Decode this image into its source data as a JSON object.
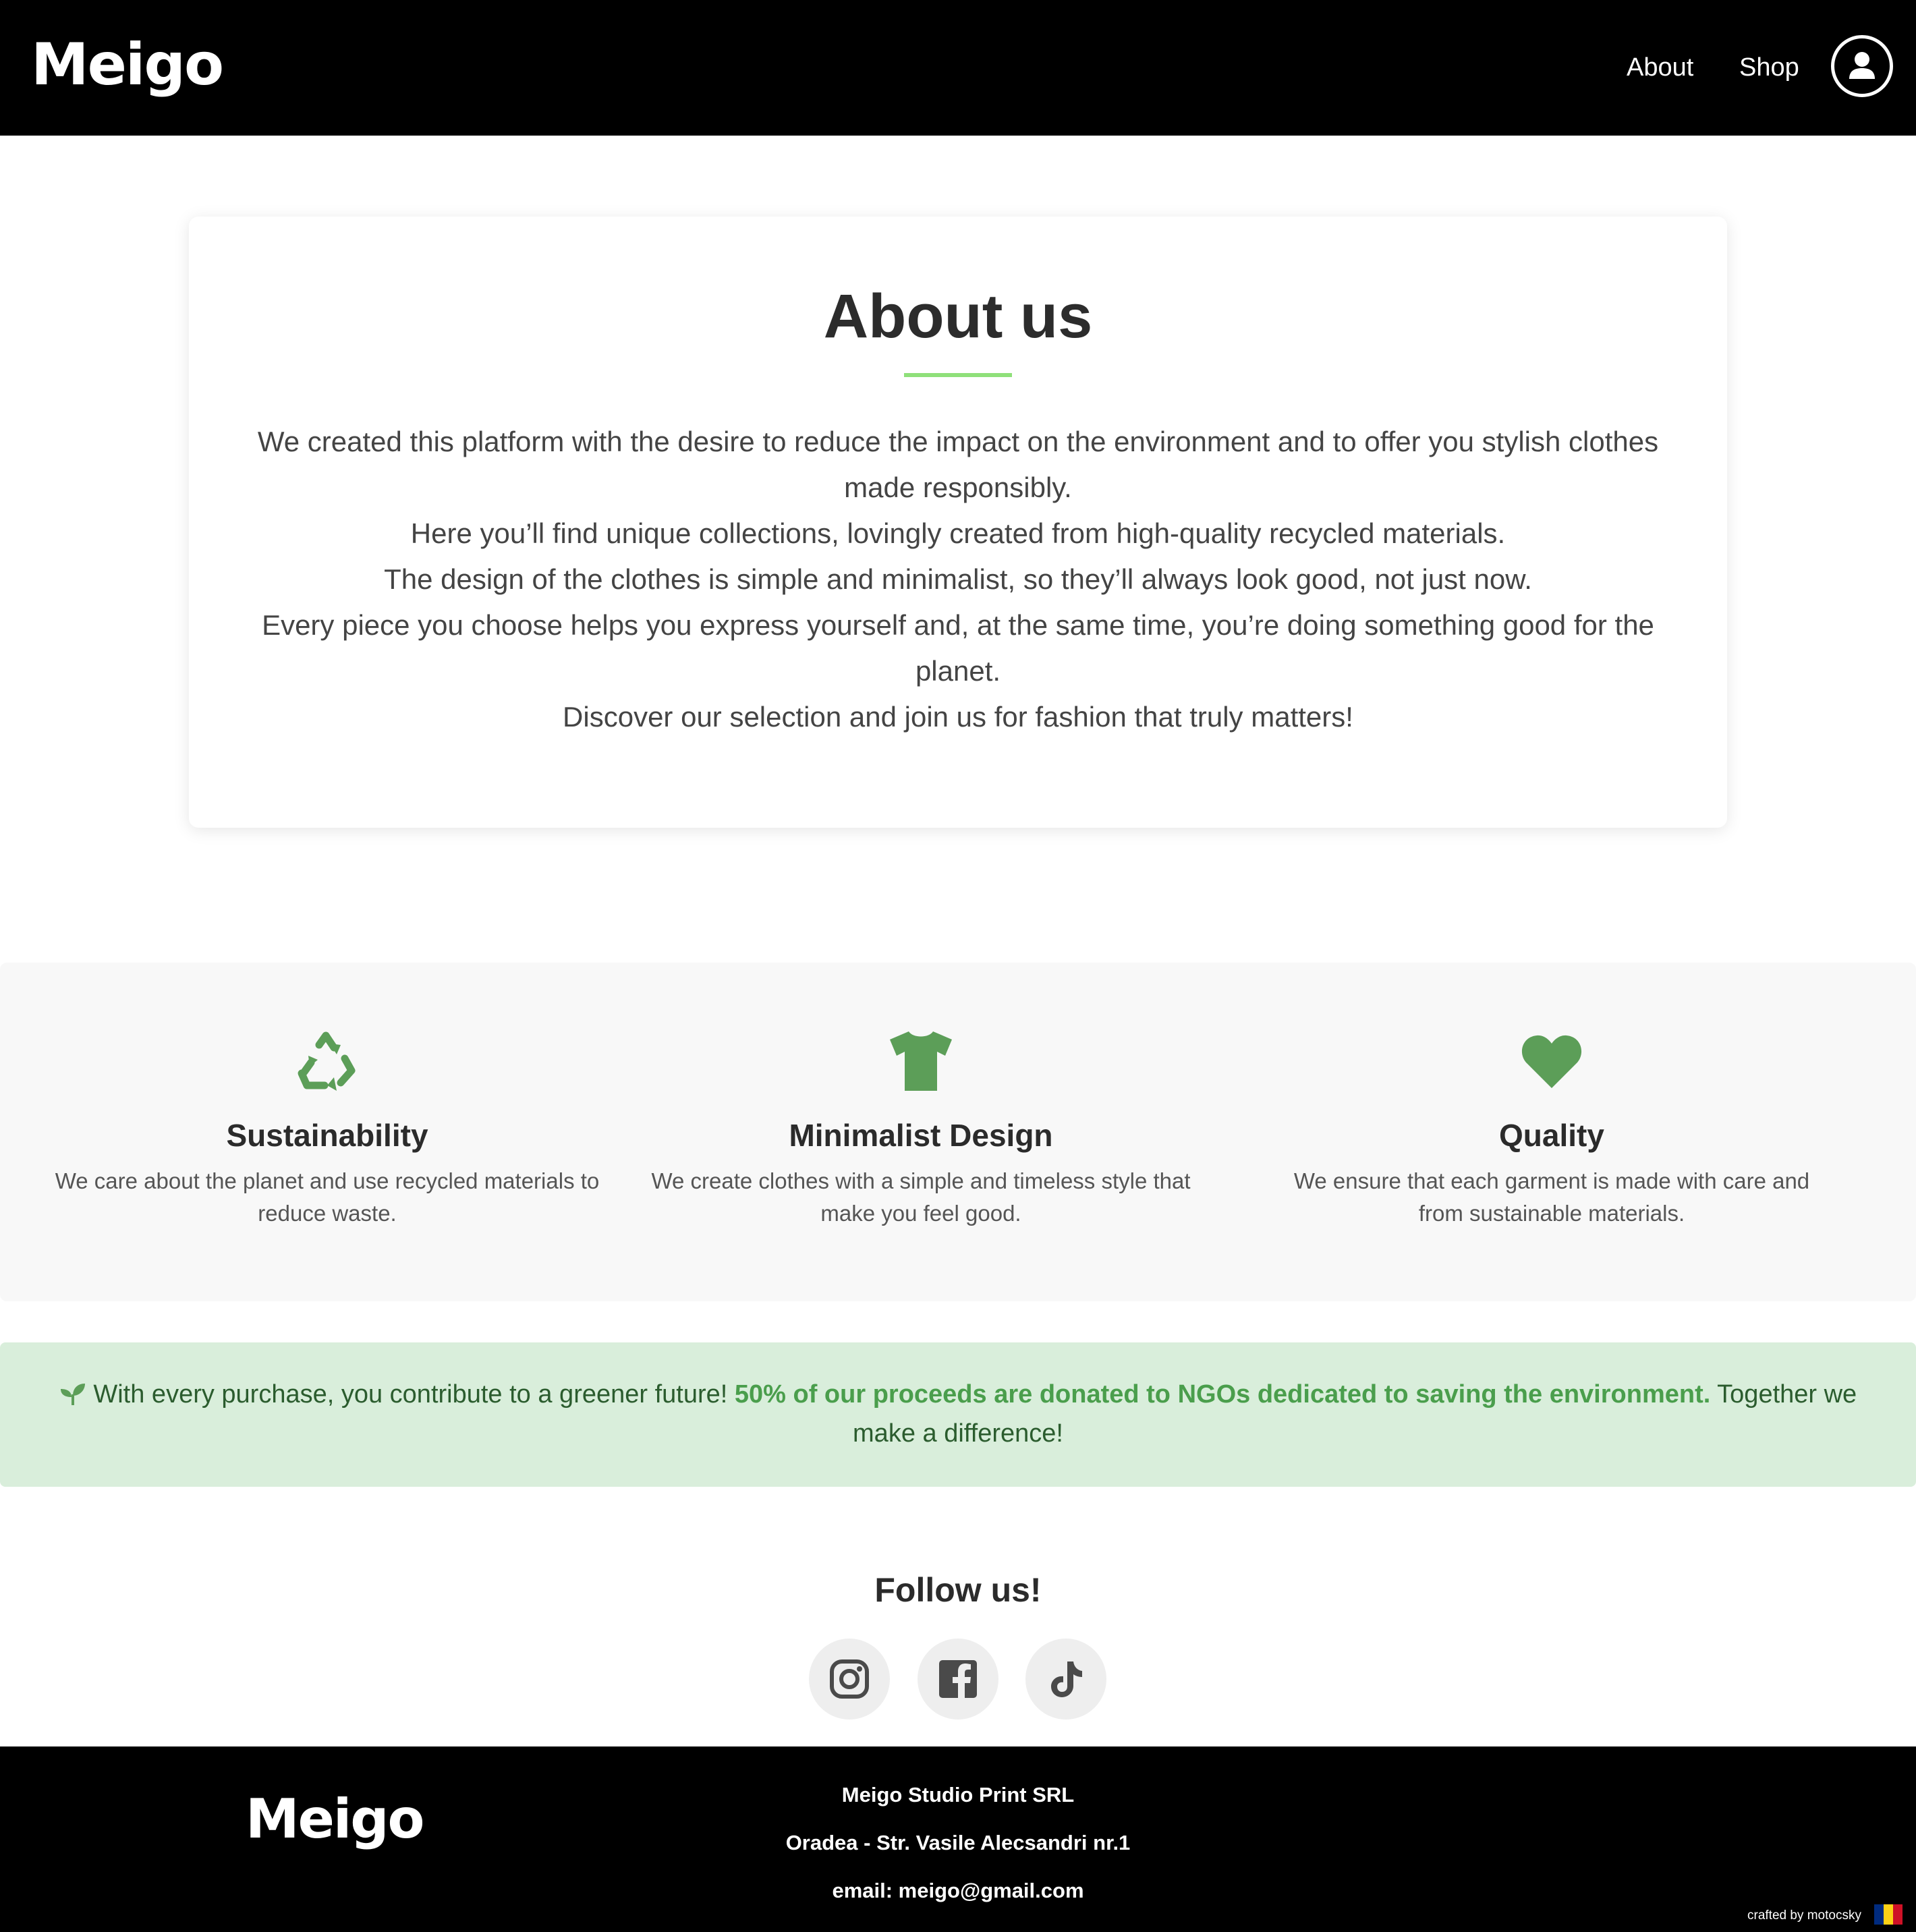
{
  "colors": {
    "header_bg": "#000000",
    "accent_green": "#4a9e4c",
    "icon_green": "#5c9e58",
    "title_rule": "#8fe07a",
    "banner_bg": "#d9eedb",
    "features_bg": "#f8f8f8"
  },
  "header": {
    "logo": "Meigo",
    "nav": {
      "about": "About",
      "shop": "Shop"
    },
    "account_icon": "user-circle-icon"
  },
  "about": {
    "title": "About us",
    "paragraphs": [
      "We created this platform with the desire to reduce the impact on the environment and to offer you stylish clothes made responsibly.",
      "Here you’ll find unique collections, lovingly created from high-quality recycled materials.",
      "The design of the clothes is simple and minimalist, so they’ll always look good, not just now.",
      "Every piece you choose helps you express yourself and, at the same time, you’re doing something good for the planet.",
      "Discover our selection and join us for fashion that truly matters!"
    ]
  },
  "features": [
    {
      "icon": "recycle-icon",
      "title": "Sustainability",
      "text": "We care about the planet and use recycled materials to reduce waste."
    },
    {
      "icon": "tshirt-icon",
      "title": "Minimalist Design",
      "text": "We create clothes with a simple and timeless style that make you feel good."
    },
    {
      "icon": "heart-icon",
      "title": "Quality",
      "text": "We ensure that each garment is made with care and from sustainable materials."
    }
  ],
  "banner": {
    "icon": "seedling-icon",
    "text_before": "With every purchase, you contribute to a greener future!",
    "text_bold": "50% of our proceeds are donated to NGOs dedicated to saving the environment.",
    "text_after": "Together we make a difference!"
  },
  "follow": {
    "title": "Follow us!",
    "icons": [
      "instagram-icon",
      "facebook-icon",
      "tiktok-icon"
    ]
  },
  "footer": {
    "logo": "Meigo",
    "company": "Meigo Studio Print SRL",
    "address": "Oradea - Str. Vasile Alecsandri nr.1",
    "email": "email: meigo@gmail.com",
    "credit": "crafted by motocsky",
    "flag_colors": [
      "#002b7f",
      "#fcd116",
      "#ce1126"
    ]
  }
}
